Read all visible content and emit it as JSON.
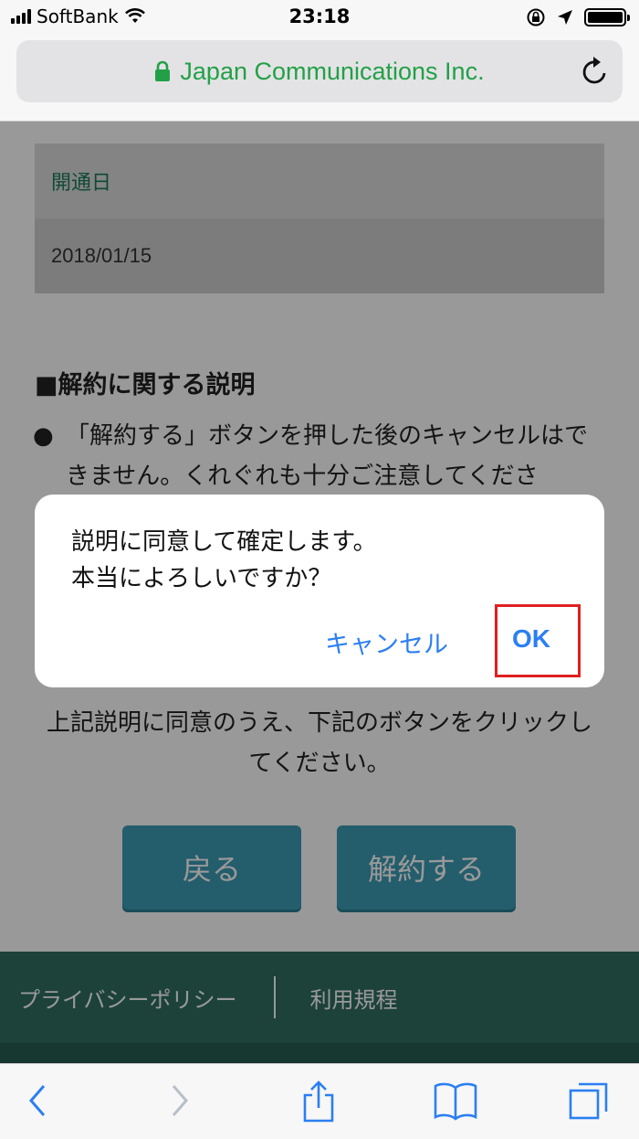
{
  "status_bar": {
    "carrier": "SoftBank",
    "time": "23:18"
  },
  "browser": {
    "url_title": "Japan Communications Inc."
  },
  "page": {
    "info_label": "開通日",
    "info_value": "2018/01/15",
    "section_heading": "■解約に関する説明",
    "bullet_text": "「解約する」ボタンを押した後のキャンセルはできません。くれぐれも十分ご注意してくださ",
    "consent_text": "上記説明に同意のうえ、下記のボタンをクリックしてください。",
    "back_button": "戻る",
    "cancel_contract_button": "解約する"
  },
  "footer": {
    "privacy_link": "プライバシーポリシー",
    "terms_link": "利用規程"
  },
  "dialog": {
    "line1": "説明に同意して確定します。",
    "line2": "本当によろしいですか？",
    "cancel_label": "キャンセル",
    "ok_label": "OK"
  },
  "colors": {
    "accent_blue": "#2b7ff2",
    "secure_green": "#23a047",
    "button_teal": "#3c9bb5",
    "footer_green": "#2f6f62",
    "highlight_red": "#e02020"
  },
  "icons": [
    "signal-icon",
    "wifi-icon",
    "lock-rotation-icon",
    "location-icon",
    "battery-icon",
    "lock-icon",
    "reload-icon",
    "back-icon",
    "forward-icon",
    "share-icon",
    "bookmarks-icon",
    "tabs-icon"
  ]
}
